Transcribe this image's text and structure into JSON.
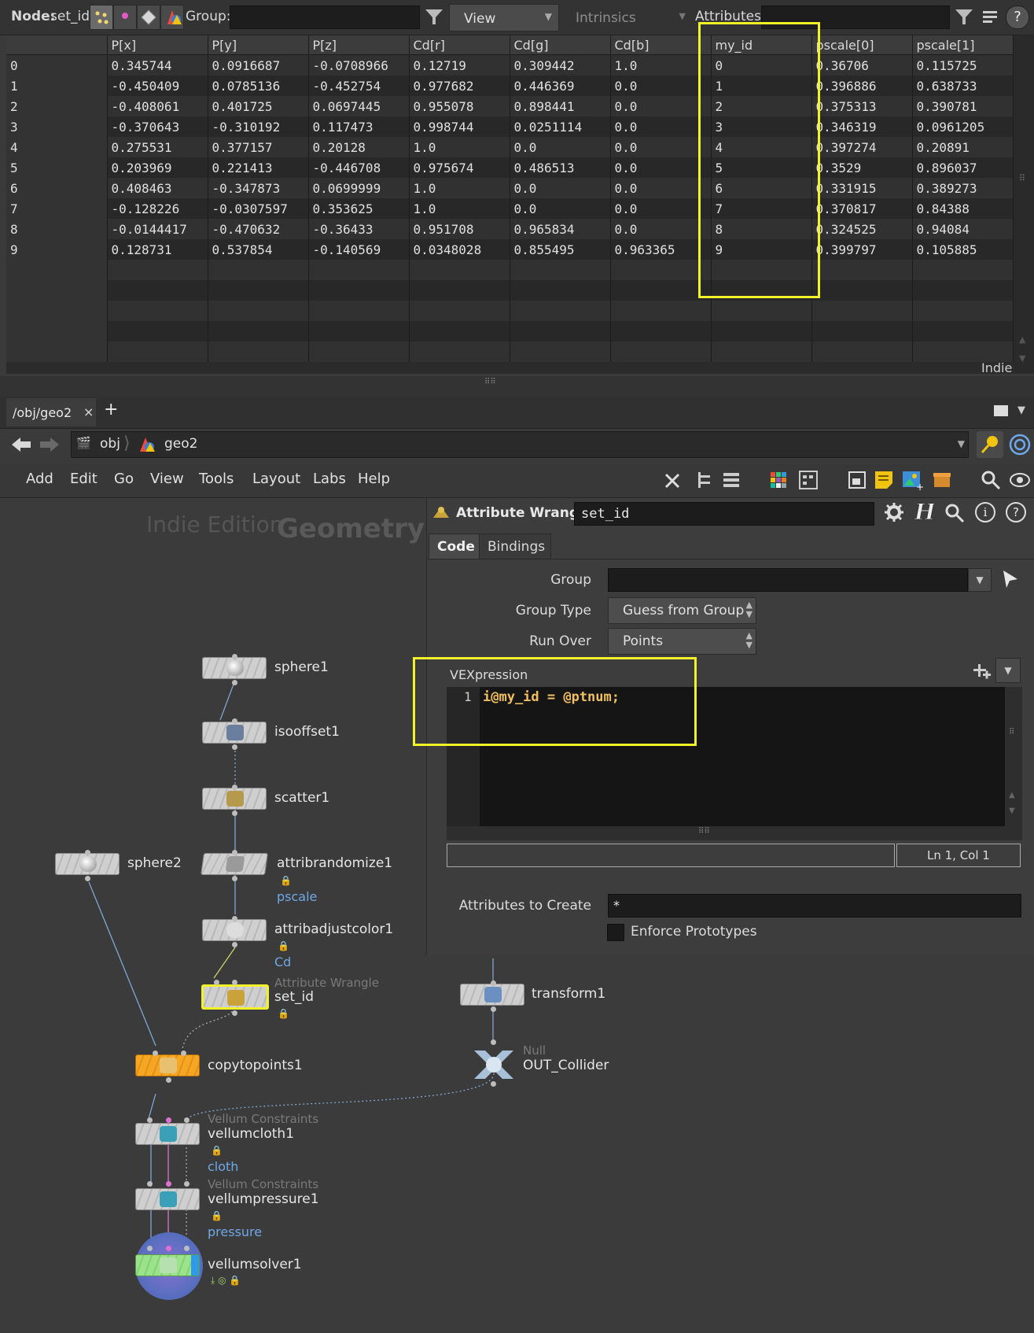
{
  "spreadsheet_toolbar": {
    "node_label": "Node:",
    "node_value": "set_id",
    "group_label": "Group:",
    "group_value": "",
    "view_label": "View",
    "intrinsics_label": "Intrinsics",
    "attributes_label": "Attributes:",
    "attributes_value": "",
    "help": "?"
  },
  "spreadsheet": {
    "columns": [
      "",
      "P[x]",
      "P[y]",
      "P[z]",
      "Cd[r]",
      "Cd[g]",
      "Cd[b]",
      "my_id",
      "pscale[0]",
      "pscale[1]"
    ],
    "rows": [
      [
        "0",
        "0.345744",
        "0.0916687",
        "-0.0708966",
        "0.12719",
        "0.309442",
        "1.0",
        "0",
        "0.36706",
        "0.115725"
      ],
      [
        "1",
        "-0.450409",
        "0.0785136",
        "-0.452754",
        "0.977682",
        "0.446369",
        "0.0",
        "1",
        "0.396886",
        "0.638733"
      ],
      [
        "2",
        "-0.408061",
        "0.401725",
        "0.0697445",
        "0.955078",
        "0.898441",
        "0.0",
        "2",
        "0.375313",
        "0.390781"
      ],
      [
        "3",
        "-0.370643",
        "-0.310192",
        "0.117473",
        "0.998744",
        "0.0251114",
        "0.0",
        "3",
        "0.346319",
        "0.0961205"
      ],
      [
        "4",
        "0.275531",
        "0.377157",
        "0.20128",
        "1.0",
        "0.0",
        "0.0",
        "4",
        "0.397274",
        "0.20891"
      ],
      [
        "5",
        "0.203969",
        "0.221413",
        "-0.446708",
        "0.975674",
        "0.486513",
        "0.0",
        "5",
        "0.3529",
        "0.896037"
      ],
      [
        "6",
        "0.408463",
        "-0.347873",
        "0.0699999",
        "1.0",
        "0.0",
        "0.0",
        "6",
        "0.331915",
        "0.389273"
      ],
      [
        "7",
        "-0.128226",
        "-0.0307597",
        "0.353625",
        "1.0",
        "0.0",
        "0.0",
        "7",
        "0.370817",
        "0.84388"
      ],
      [
        "8",
        "-0.0144417",
        "-0.470632",
        "-0.36433",
        "0.951708",
        "0.965834",
        "0.0",
        "8",
        "0.324525",
        "0.94084"
      ],
      [
        "9",
        "0.128731",
        "0.537854",
        "-0.140569",
        "0.0348028",
        "0.855495",
        "0.963365",
        "9",
        "0.399797",
        "0.105885"
      ]
    ],
    "watermark": "Indie"
  },
  "tabs": {
    "active": "/obj/geo2",
    "close": "×",
    "add": "+"
  },
  "path": {
    "obj": "obj",
    "geo2": "geo2"
  },
  "menu": [
    "Add",
    "Edit",
    "Go",
    "View",
    "Tools",
    "Layout",
    "Labs",
    "Help"
  ],
  "network": {
    "watermark_edition": "Indie Edition",
    "watermark_context": "Geometry",
    "nodes": {
      "sphere1": "sphere1",
      "isooffset1": "isooffset1",
      "scatter1": "scatter1",
      "sphere2": "sphere2",
      "attribrandomize1": "attribrandomize1",
      "attribrandomize1_flag": "pscale",
      "attribadjustcolor1": "attribadjustcolor1",
      "attribadjustcolor1_flag": "Cd",
      "set_id_type": "Attribute Wrangle",
      "set_id": "set_id",
      "transform1": "transform1",
      "copytopoints1": "copytopoints1",
      "out_type": "Null",
      "out": "OUT_Collider",
      "vellumcloth1_type": "Vellum Constraints",
      "vellumcloth1": "vellumcloth1",
      "vellumcloth1_flag": "cloth",
      "vellumpressure1_type": "Vellum Constraints",
      "vellumpressure1": "vellumpressure1",
      "vellumpressure1_flag": "pressure",
      "vellumsolver1": "vellumsolver1"
    }
  },
  "params": {
    "node_type": "Attribute Wrangle",
    "node_name": "set_id",
    "tab_code": "Code",
    "tab_bindings": "Bindings",
    "group_label": "Group",
    "group_value": "",
    "group_type_label": "Group Type",
    "group_type_value": "Guess from Group",
    "run_over_label": "Run Over",
    "run_over_value": "Points",
    "vex_label": "VEXpression",
    "vex_line_no": "1",
    "vex_code": "i@my_id = @ptnum;",
    "cursor_status": "Ln 1, Col 1",
    "attrs_create_label": "Attributes to Create",
    "attrs_create_value": "*",
    "enforce_label": "Enforce Prototypes"
  },
  "colors": {
    "highlight": "#f2f22a",
    "flag_blue": "#6fa8e8",
    "copytopoints": "#f5a623",
    "solver": "#9be38a",
    "vex_code": "#f0c060"
  }
}
